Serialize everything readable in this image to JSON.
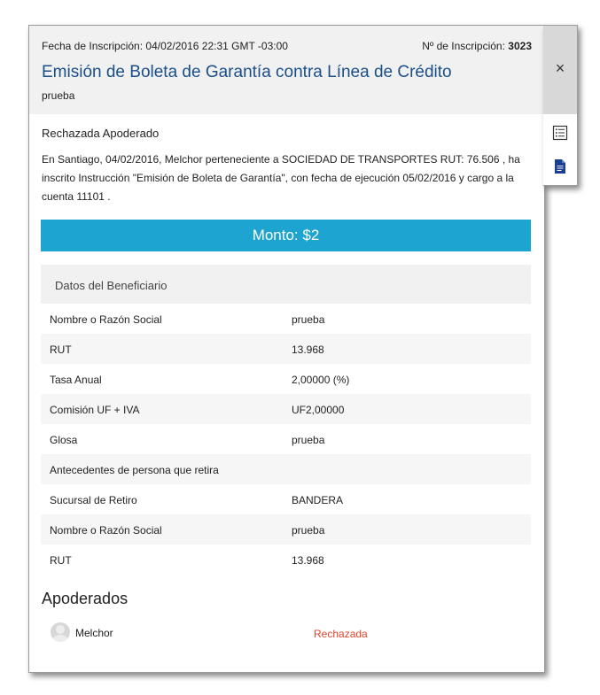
{
  "header": {
    "date_text": "Fecha de Inscripción: 04/02/2016 22:31 GMT -03:00",
    "inscription_label": "Nº de Inscripción:",
    "inscription_number": "3023",
    "title": "Emisión de Boleta de Garantía contra Línea de Crédito",
    "subtitle": "prueba"
  },
  "side": {
    "close_icon": "close-icon",
    "list_icon": "list-icon",
    "document_icon": "document-icon"
  },
  "status_text": "Rechazada Apoderado",
  "paragraph": "En Santiago, 04/02/2016, Melchor                                             perteneciente a SOCIEDAD DE TRANSPORTES                                           RUT: 76.506           , ha inscrito Instrucción \"Emisión de Boleta de Garantía\", con fecha de ejecución 05/02/2016 y cargo a la cuenta 11101           .",
  "monto": "Monto: $2",
  "beneficiary": {
    "header": "Datos del Beneficiario",
    "rows": [
      {
        "label": "Nombre o Razón Social",
        "value": "prueba"
      },
      {
        "label": "RUT",
        "value": "13.968"
      },
      {
        "label": "Tasa Anual",
        "value": "2,00000 (%)"
      },
      {
        "label": "Comisión UF + IVA",
        "value": "UF2,00000"
      },
      {
        "label": "Glosa",
        "value": "prueba"
      },
      {
        "label": "Antecedentes de persona que retira",
        "value": ""
      },
      {
        "label": "Sucursal de Retiro",
        "value": "BANDERA"
      },
      {
        "label": "Nombre o Razón Social",
        "value": "prueba"
      },
      {
        "label": "RUT",
        "value": "13.968"
      }
    ]
  },
  "apoderados": {
    "title": "Apoderados",
    "items": [
      {
        "name": "Melchor",
        "status": "Rechazada"
      }
    ]
  },
  "colors": {
    "title": "#1a4f8a",
    "monto_bg": "#1da4d1",
    "rejected": "#e2452b",
    "doc_icon": "#1a3f8f"
  }
}
